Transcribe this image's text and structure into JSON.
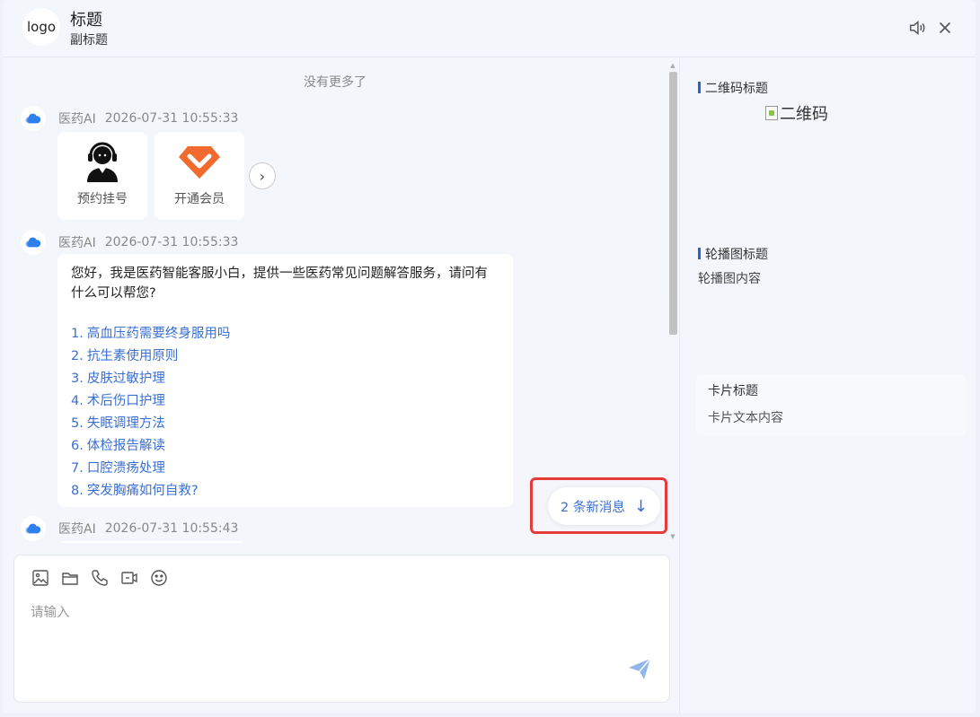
{
  "header": {
    "logo_text": "logo",
    "title": "标题",
    "subtitle": "副标题"
  },
  "chat": {
    "no_more_text": "没有更多了",
    "messages": [
      {
        "sender": "医药AI",
        "time": "2026-07-31 10:55:33"
      },
      {
        "sender": "医药AI",
        "time": "2026-07-31 10:55:33"
      },
      {
        "sender": "医药AI",
        "time": "2026-07-31 10:55:43"
      }
    ],
    "service_cards": [
      {
        "label": "预约挂号",
        "icon": "customer-service-agent-icon"
      },
      {
        "label": "开通会员",
        "icon": "vip-diamond-icon"
      }
    ],
    "greeting": "您好，我是医药智能客服小白，提供一些医药常见问题解答服务，请问有什么可以帮您?",
    "questions": [
      {
        "num": "1.",
        "text": "高血压药需要终身服用吗"
      },
      {
        "num": "2.",
        "text": "抗生素使用原则"
      },
      {
        "num": "3.",
        "text": "皮肤过敏护理"
      },
      {
        "num": "4.",
        "text": "术后伤口护理"
      },
      {
        "num": "5.",
        "text": "失眠调理方法"
      },
      {
        "num": "6.",
        "text": "体检报告解读"
      },
      {
        "num": "7.",
        "text": "口腔溃疡处理"
      },
      {
        "num": "8.",
        "text": "突发胸痛如何自救?"
      }
    ],
    "new_message_label": "2 条新消息",
    "new_message_arrow": "↓"
  },
  "input": {
    "placeholder": "请输入",
    "tools": [
      "image-icon",
      "folder-icon",
      "phone-icon",
      "video-icon",
      "emoji-icon"
    ]
  },
  "side": {
    "qr_title": "二维码标题",
    "qr_alt": "二维码",
    "carousel_title": "轮播图标题",
    "carousel_content": "轮播图内容",
    "card_title": "卡片标题",
    "card_text": "卡片文本内容"
  },
  "colors": {
    "accent": "#3a6fd0",
    "highlight_frame": "#e53b3b",
    "section_bar": "#2a5fd6"
  }
}
